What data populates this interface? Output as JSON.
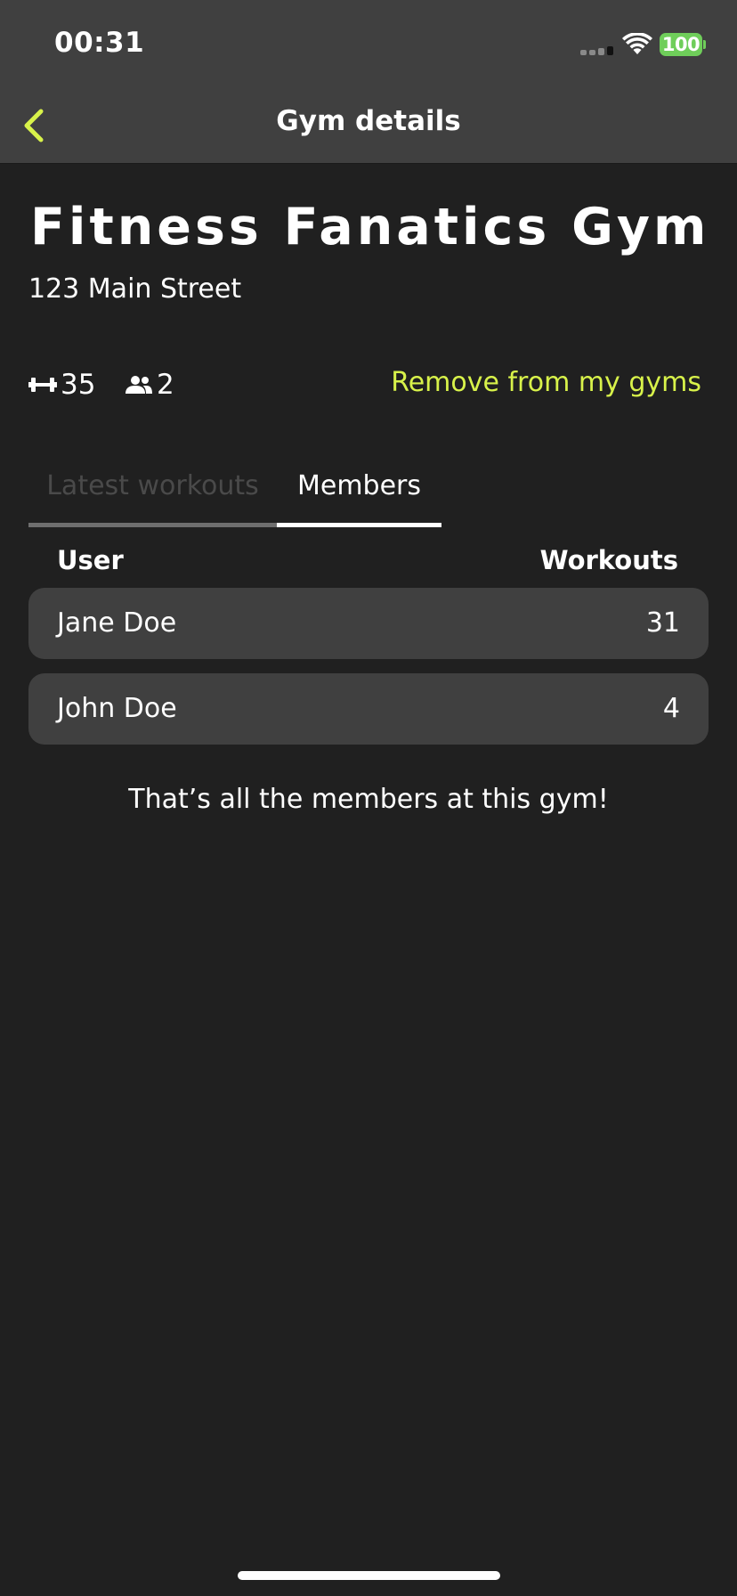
{
  "status_bar": {
    "time": "00:31",
    "battery": "100",
    "battery_color": "#6fce5a"
  },
  "nav": {
    "title": "Gym details",
    "back_icon": "chevron-left-icon",
    "accent_color": "#d8f24a"
  },
  "gym": {
    "name": "Fitness Fanatics Gym",
    "address": "123 Main Street",
    "workouts_count": "35",
    "workouts_icon": "dumbbell-icon",
    "members_count": "2",
    "members_icon": "users-icon",
    "remove_label": "Remove from my gyms"
  },
  "tabs": [
    {
      "label": "Latest workouts",
      "active": false
    },
    {
      "label": "Members",
      "active": true
    }
  ],
  "members_table": {
    "columns": [
      "User",
      "Workouts"
    ],
    "rows": [
      {
        "user": "Jane Doe",
        "workouts": "31"
      },
      {
        "user": "John Doe",
        "workouts": "4"
      }
    ],
    "end_note": "That’s all the members at this gym!"
  }
}
